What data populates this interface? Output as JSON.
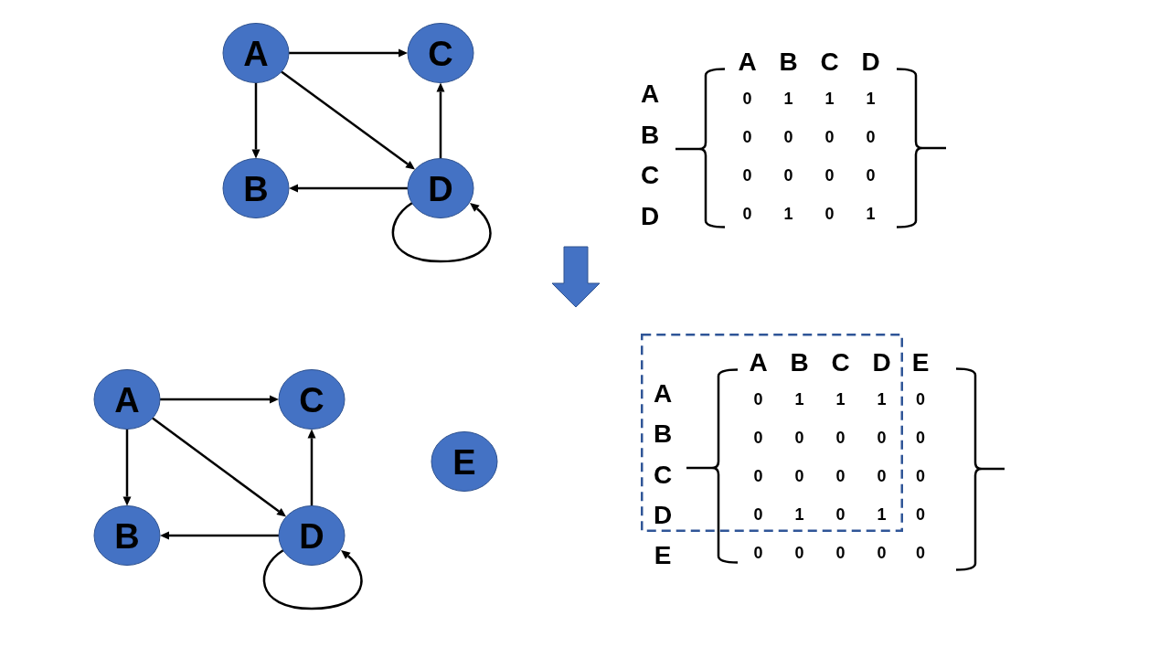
{
  "stages": [
    {
      "graph": {
        "nodes": [
          {
            "label": "A"
          },
          {
            "label": "C"
          },
          {
            "label": "B"
          },
          {
            "label": "D"
          }
        ]
      },
      "matrix": {
        "dashed_outline": false,
        "column_headers": [
          "A",
          "B",
          "C",
          "D"
        ],
        "rows": [
          {
            "label": "A",
            "cells": [
              "0",
              "1",
              "1",
              "1"
            ]
          },
          {
            "label": "B",
            "cells": [
              "0",
              "0",
              "0",
              "0"
            ]
          },
          {
            "label": "C",
            "cells": [
              "0",
              "0",
              "0",
              "0"
            ]
          },
          {
            "label": "D",
            "cells": [
              "0",
              "1",
              "0",
              "1"
            ]
          }
        ]
      }
    },
    {
      "graph": {
        "nodes": [
          {
            "label": "A"
          },
          {
            "label": "C"
          },
          {
            "label": "E"
          },
          {
            "label": "B"
          },
          {
            "label": "D"
          }
        ]
      },
      "matrix": {
        "dashed_outline": true,
        "column_headers": [
          "A",
          "B",
          "C",
          "D",
          "E"
        ],
        "rows": [
          {
            "label": "A",
            "cells": [
              "0",
              "1",
              "1",
              "1",
              "0"
            ]
          },
          {
            "label": "B",
            "cells": [
              "0",
              "0",
              "0",
              "0",
              "0"
            ]
          },
          {
            "label": "C",
            "cells": [
              "0",
              "0",
              "0",
              "0",
              "0"
            ]
          },
          {
            "label": "D",
            "cells": [
              "0",
              "1",
              "0",
              "1",
              "0"
            ]
          },
          {
            "label": "E",
            "cells": [
              "0",
              "0",
              "0",
              "0",
              "0"
            ]
          }
        ]
      }
    }
  ]
}
